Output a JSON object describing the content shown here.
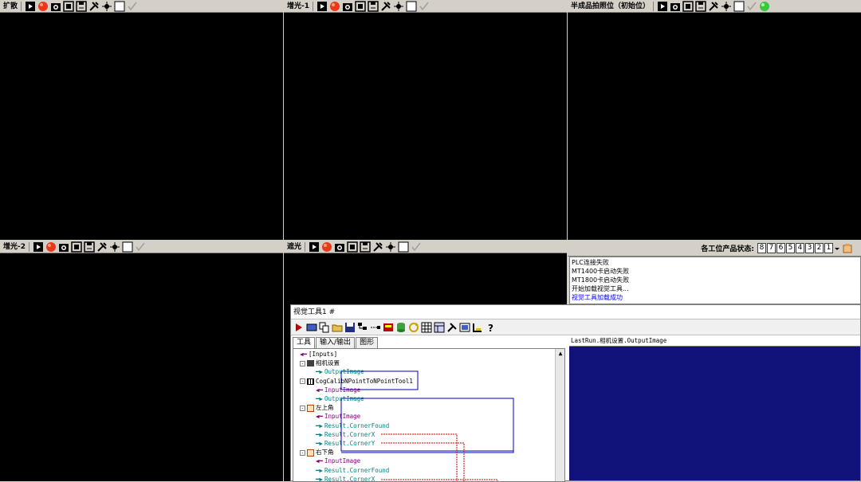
{
  "panes": [
    {
      "title": "扩散",
      "extra_green": false
    },
    {
      "title": "增光-1",
      "extra_green": false
    },
    {
      "title": "半成品拍照位（初始位）",
      "extra_green": true
    },
    {
      "title": "增光-2",
      "extra_green": false
    },
    {
      "title": "遮光",
      "extra_green": false
    }
  ],
  "status": {
    "label": "各工位产品状态:",
    "slots": [
      "8",
      "7",
      "6",
      "5",
      "4",
      "3",
      "2",
      "1"
    ],
    "log": [
      "PLC连接失败",
      "MT1400卡启动失败",
      "MT1800卡启动失败",
      "开始加载视觉工具...",
      "视觉工具加载成功"
    ]
  },
  "tool": {
    "title": "视觉工具1 #",
    "tabs": [
      "工具",
      "输入/输出",
      "图形"
    ],
    "image_label": "LastRun.相机设置.OutputImage",
    "tree": [
      {
        "text": "[Inputs]",
        "cls": "",
        "indent": 0,
        "arrow": "in"
      },
      {
        "text": "相机设置",
        "cls": "",
        "indent": 0,
        "node": "camera"
      },
      {
        "text": "OutputImage",
        "cls": "teal",
        "indent": 1,
        "arrow": "out"
      },
      {
        "text": "CogCalibNPointToNPointTool1",
        "cls": "",
        "indent": 0,
        "node": "calib"
      },
      {
        "text": "InputImage",
        "cls": "purple",
        "indent": 1,
        "arrow": "in"
      },
      {
        "text": "OutputImage",
        "cls": "teal",
        "indent": 1,
        "arrow": "out"
      },
      {
        "text": "左上角",
        "cls": "",
        "indent": 0,
        "node": "search"
      },
      {
        "text": "InputImage",
        "cls": "purple",
        "indent": 1,
        "arrow": "in"
      },
      {
        "text": "Result.CornerFound",
        "cls": "teal",
        "indent": 1,
        "arrow": "out"
      },
      {
        "text": "Result.CornerX",
        "cls": "teal",
        "indent": 1,
        "arrow": "out"
      },
      {
        "text": "Result.CornerY",
        "cls": "teal",
        "indent": 1,
        "arrow": "out"
      },
      {
        "text": "右下角",
        "cls": "",
        "indent": 0,
        "node": "search"
      },
      {
        "text": "InputImage",
        "cls": "purple",
        "indent": 1,
        "arrow": "in"
      },
      {
        "text": "Result.CornerFound",
        "cls": "teal",
        "indent": 1,
        "arrow": "out"
      },
      {
        "text": "Result.CornerX",
        "cls": "teal",
        "indent": 1,
        "arrow": "out"
      }
    ]
  }
}
